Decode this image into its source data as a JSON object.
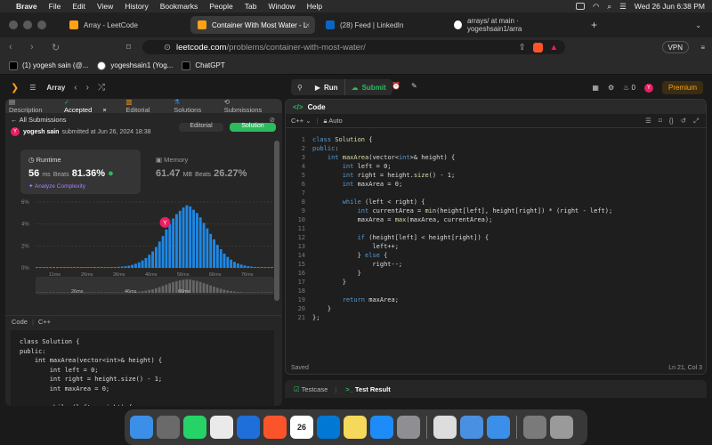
{
  "menubar": {
    "apple": "",
    "app": "Brave",
    "items": [
      "File",
      "Edit",
      "View",
      "History",
      "Bookmarks",
      "People",
      "Tab",
      "Window",
      "Help"
    ],
    "clock": "Wed 26 Jun  6:38 PM"
  },
  "tabs": [
    {
      "label": "Array - LeetCode",
      "color": "#ffa116"
    },
    {
      "label": "Container With Most Water - L",
      "color": "#ffa116",
      "active": true
    },
    {
      "label": "(28) Feed | LinkedIn",
      "color": "#0a66c2"
    },
    {
      "label": "arrays/ at main · yogeshsain1/arra",
      "color": "#ffffff"
    }
  ],
  "url": {
    "host": "leetcode.com",
    "path": "/problems/container-with-most-water/",
    "vpn": "VPN"
  },
  "bookmarks": [
    {
      "label": "(1) yogesh sain (@..."
    },
    {
      "label": "yogeshsain1 (Yog..."
    },
    {
      "label": "ChatGPT"
    }
  ],
  "lc": {
    "section": "Array",
    "run": "Run",
    "submit": "Submit",
    "fire": "0",
    "avatar": "Y",
    "premium": "Premium"
  },
  "left": {
    "tabs": [
      "Description",
      "Accepted",
      "Editorial",
      "Solutions",
      "Submissions"
    ],
    "all": "All Submissions",
    "user": "yogesh sain",
    "submitted": "submitted at Jun 26, 2024 18:38",
    "editorial_btn": "Editorial",
    "solution_btn": "Solution",
    "runtime": {
      "label": "Runtime",
      "value": "56",
      "unit": "ms",
      "beats_label": "Beats",
      "beats": "81.36%",
      "analyze": "Analyze Complexity"
    },
    "memory": {
      "label": "Memory",
      "value": "61.47",
      "unit": "MB",
      "beats_label": "Beats",
      "beats": "26.27%"
    },
    "code_label": "Code",
    "lang": "C++",
    "code": "class Solution {\npublic:\n    int maxArea(vector<int>& height) {\n        int left = 0;\n        int right = height.size() - 1;\n        int maxArea = 0;\n\n        while (left < right) {"
  },
  "right": {
    "title": "Code",
    "lang": "C++",
    "auto": "Auto",
    "saved": "Saved",
    "pos": "Ln 21, Col 3"
  },
  "editor_lines": [
    "class Solution {",
    "public:",
    "    int maxArea(vector<int>& height) {",
    "        int left = 0;",
    "        int right = height.size() - 1;",
    "        int maxArea = 0;",
    "",
    "        while (left < right) {",
    "            int currentArea = min(height[left], height[right]) * (right - left);",
    "            maxArea = max(maxArea, currentArea);",
    "",
    "            if (height[left] < height[right]) {",
    "                left++;",
    "            } else {",
    "                right--;",
    "            }",
    "        }",
    "",
    "        return maxArea;",
    "    }",
    "};"
  ],
  "testcase": {
    "tab1": "Testcase",
    "tab2": "Test Result"
  },
  "chart_data": {
    "type": "bar",
    "ylabels": [
      "6%",
      "4%",
      "2%",
      "0%"
    ],
    "xlabels": [
      "11ms",
      "26ms",
      "36ms",
      "46ms",
      "56ms",
      "66ms",
      "76ms"
    ],
    "minilabels": [
      "26ms",
      "46ms",
      "66ms"
    ],
    "marker": "Y",
    "ylim": [
      0,
      6
    ],
    "values": [
      0.05,
      0.05,
      0.05,
      0.05,
      0.05,
      0.05,
      0.05,
      0.05,
      0.05,
      0.05,
      0.05,
      0.05,
      0.05,
      0.05,
      0.05,
      0.05,
      0.05,
      0.05,
      0.05,
      0.05,
      0.06,
      0.06,
      0.07,
      0.08,
      0.1,
      0.12,
      0.15,
      0.2,
      0.28,
      0.38,
      0.5,
      0.68,
      0.9,
      1.2,
      1.5,
      1.9,
      2.4,
      2.9,
      3.5,
      4.0,
      4.5,
      4.9,
      5.2,
      5.5,
      5.7,
      5.6,
      5.3,
      5.0,
      4.6,
      4.1,
      3.6,
      3.1,
      2.6,
      2.1,
      1.7,
      1.3,
      1.0,
      0.75,
      0.55,
      0.4,
      0.3,
      0.22,
      0.16,
      0.12,
      0.09,
      0.07,
      0.06,
      0.05,
      0.05,
      0.05
    ]
  },
  "dock": [
    {
      "name": "finder",
      "color": "#3b8fe8",
      "label": ""
    },
    {
      "name": "launchpad",
      "color": "#6a6a6a",
      "label": ""
    },
    {
      "name": "whatsapp",
      "color": "#25d366",
      "label": ""
    },
    {
      "name": "chrome",
      "color": "#eaeaea",
      "label": ""
    },
    {
      "name": "screen",
      "color": "#1e6fd9",
      "label": ""
    },
    {
      "name": "brave",
      "color": "#fb542b",
      "label": ""
    },
    {
      "name": "calendar",
      "color": "#ffffff",
      "label": "26"
    },
    {
      "name": "vscode",
      "color": "#0078d4",
      "label": ""
    },
    {
      "name": "notes",
      "color": "#f6d85b",
      "label": ""
    },
    {
      "name": "appstore",
      "color": "#1d8cf8",
      "label": ""
    },
    {
      "name": "settings",
      "color": "#8e8e93",
      "label": ""
    },
    {
      "name": "textedit",
      "color": "#dddddd",
      "label": ""
    },
    {
      "name": "preview",
      "color": "#4a90e2",
      "label": ""
    },
    {
      "name": "mail",
      "color": "#3b8fe8",
      "label": ""
    },
    {
      "name": "folder",
      "color": "#7a7a7a",
      "label": ""
    },
    {
      "name": "trash",
      "color": "#9a9a9a",
      "label": ""
    }
  ]
}
